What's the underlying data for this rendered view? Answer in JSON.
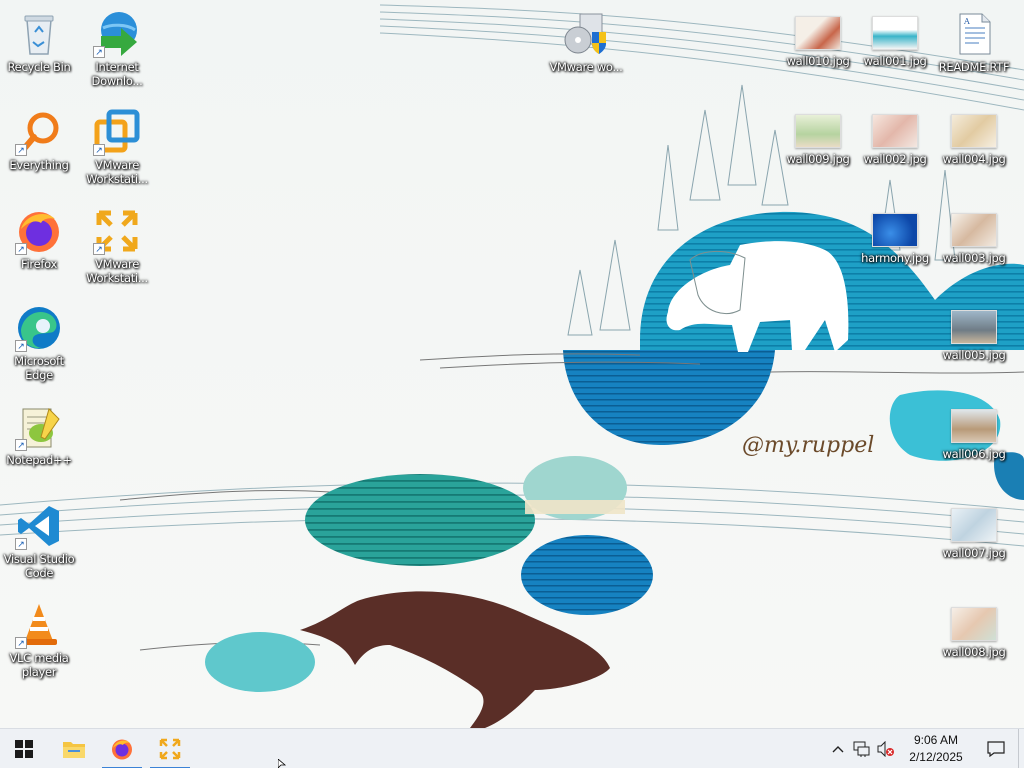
{
  "desktop": {
    "left_icons": [
      {
        "label": "Recycle Bin",
        "icon": "recycle-bin-icon"
      },
      {
        "label": "Everything",
        "icon": "everything-search-icon"
      },
      {
        "label": "Firefox",
        "icon": "firefox-icon"
      },
      {
        "label": "Microsoft Edge",
        "icon": "edge-icon"
      },
      {
        "label": "Notepad++",
        "icon": "notepad-plus-plus-icon"
      },
      {
        "label": "Visual Studio Code",
        "icon": "vscode-icon"
      },
      {
        "label": "VLC media player",
        "icon": "vlc-icon"
      }
    ],
    "second_column": [
      {
        "label": "Internet Downlo...",
        "icon": "internet-download-manager-icon"
      },
      {
        "label": "VMware Workstati...",
        "icon": "vmware-workstation-icon"
      },
      {
        "label": "VMware Workstati...",
        "icon": "vmware-player-icon"
      }
    ],
    "center_icon": {
      "label": "VMware wo...",
      "icon": "vmware-installer-icon"
    },
    "right_files": [
      {
        "label": "wall010.jpg"
      },
      {
        "label": "wall001.jpg"
      },
      {
        "label": "README.RTF"
      },
      {
        "label": "wall009.jpg"
      },
      {
        "label": "wall002.jpg"
      },
      {
        "label": "wall004.jpg"
      },
      {
        "label": "harmony.jpg"
      },
      {
        "label": "wall003.jpg"
      },
      {
        "label": "wall005.jpg"
      },
      {
        "label": "wall006.jpg"
      },
      {
        "label": "wall007.jpg"
      },
      {
        "label": "wall008.jpg"
      }
    ],
    "wallpaper_signature": "@my.ruppel"
  },
  "taskbar": {
    "start_icon": "windows-start-icon",
    "pinned": [
      {
        "name": "file-explorer",
        "icon": "folder-icon"
      },
      {
        "name": "firefox",
        "icon": "firefox-icon"
      },
      {
        "name": "vmware-workstation",
        "icon": "vmware-icon"
      }
    ],
    "clock_time": "9:06 AM",
    "clock_date": "2/12/2025"
  },
  "colors": {
    "taskbar_bg": "#eef1f5",
    "accent": "#3b82d6",
    "wall_teal": "#1aa3c4",
    "wall_brown": "#5a2e27"
  }
}
